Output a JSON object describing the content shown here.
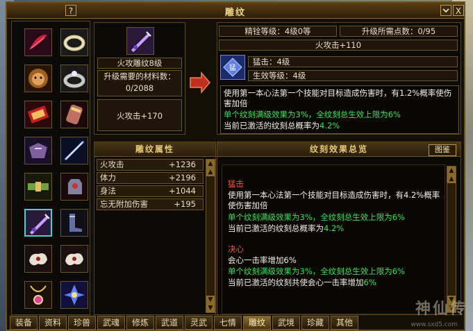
{
  "window": {
    "title": "雕纹",
    "help_label": "?",
    "close_label": "X"
  },
  "left_slots": [
    {
      "icon": "red-feather-icon"
    },
    {
      "icon": "silver-ring-icon"
    },
    {
      "icon": "lion-mask-icon"
    },
    {
      "icon": "jeweled-ring-icon"
    },
    {
      "icon": "red-scroll-icon"
    },
    {
      "icon": "bracer-icon"
    },
    {
      "icon": "purple-armor-icon"
    },
    {
      "icon": "blue-blade-icon"
    },
    {
      "icon": "green-belt-icon"
    },
    {
      "icon": "gauntlet-icon"
    },
    {
      "icon": "purple-sword-icon",
      "selected": true
    },
    {
      "icon": "boots-icon"
    },
    {
      "icon": "white-cloud-icon"
    },
    {
      "icon": "white-cloud-icon"
    },
    {
      "icon": "pendant-icon"
    },
    {
      "icon": "dragon-emblem-icon"
    }
  ],
  "item": {
    "name": "火攻雕纹8级",
    "req_label": "升级需要的材料数：",
    "req_value": "0/2088",
    "effect": "火攻击+170"
  },
  "top_info": {
    "refine_label": "精铨等级：4级0等",
    "upgrade_label": "升级所需点数：0/95",
    "fire_attack": "火攻击+110",
    "skill_name": "猛击：4级",
    "effect_level": "生效等级：4级",
    "desc1": "使用第一本心法第一个技能对目标造成伤害时，有1.2%概率使伤害加倍",
    "green1": "单个纹刻满级效果为3%，全纹刻总生效上限为6%",
    "desc_prefix": "当前已激活的纹刻总概率为",
    "desc_value": "4.2%"
  },
  "attr_panel": {
    "title": "雕纹属性",
    "rows": [
      {
        "name": "火攻击",
        "value": "+1236"
      },
      {
        "name": "体力",
        "value": "+2196"
      },
      {
        "name": "身法",
        "value": "+1044"
      },
      {
        "name": "忘无附加伤害",
        "value": "+195"
      }
    ]
  },
  "summary_panel": {
    "title": "纹刻效果总览",
    "guide_button": "图鉴",
    "entries": [
      {
        "name": "猛击",
        "desc": "使用第一本心法第一个技能对目标造成伤害时，有4.2%概率使伤害加倍",
        "green": "单个纹刻满级效果为3%，全纹刻总生效上限为6%",
        "active_prefix": "当前已激活的纹刻总概率为",
        "active_value": "4.2%"
      },
      {
        "name": "决心",
        "desc": "会心一击率增加6%",
        "green": "单个纹刻满级效果为3%，全纹刻总生效上限为6%",
        "active_prefix": "当前已激活的纹刻共使会心一击率增加",
        "active_value": "6%"
      }
    ]
  },
  "tabs": [
    "装备",
    "资料",
    "珍兽",
    "武魂",
    "修炼",
    "武道",
    "灵武",
    "七情",
    "雕纹",
    "武境",
    "珍藏",
    "其他"
  ],
  "active_tab": "雕纹",
  "watermark": {
    "text": "神仙传",
    "url": "www.sxd5.com"
  }
}
